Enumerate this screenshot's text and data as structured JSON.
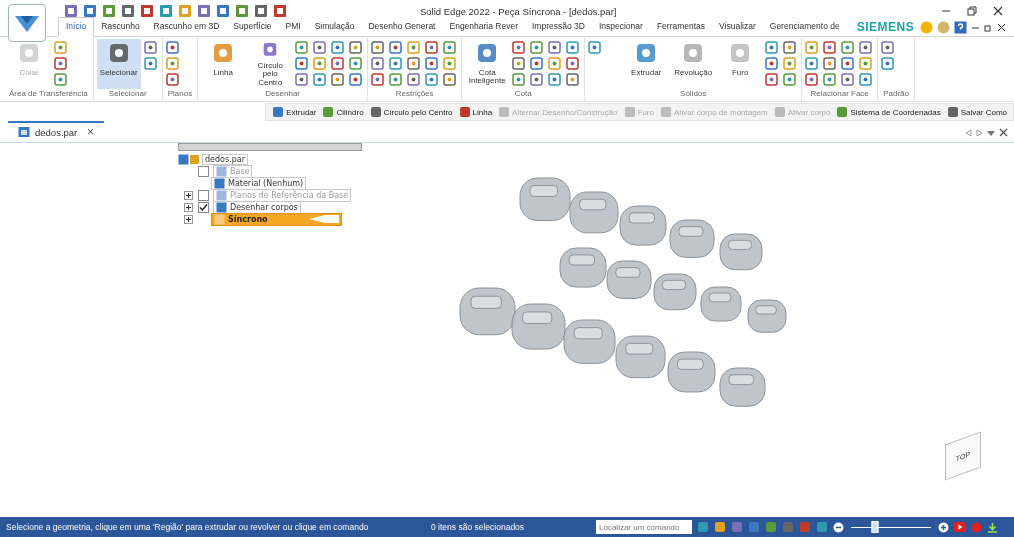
{
  "window": {
    "title": "Solid Edge 2022 - Peça Síncrona - [dedos.par]"
  },
  "tabs": [
    {
      "label": "Início",
      "selected": true
    },
    {
      "label": "Rascunho",
      "selected": false
    },
    {
      "label": "Rascunho em 3D",
      "selected": false
    },
    {
      "label": "Superfície",
      "selected": false
    },
    {
      "label": "PMI",
      "selected": false
    },
    {
      "label": "Simulação",
      "selected": false
    },
    {
      "label": "Desenho Generat",
      "selected": false
    },
    {
      "label": "Engenharia Rever",
      "selected": false
    },
    {
      "label": "Impressão 3D",
      "selected": false
    },
    {
      "label": "Inspecionar",
      "selected": false
    },
    {
      "label": "Ferramentas",
      "selected": false
    },
    {
      "label": "Visualizar",
      "selected": false
    },
    {
      "label": "Gerenciamento de",
      "selected": false
    }
  ],
  "brand": "SIEMENS",
  "ribbon": [
    {
      "label": "Área de Transferência",
      "buttons": [
        {
          "label": "Colar",
          "disabled": true,
          "selected": false
        }
      ]
    },
    {
      "label": "Selecionar",
      "buttons": [
        {
          "label": "Selecionar",
          "disabled": false,
          "selected": true
        }
      ]
    },
    {
      "label": "Planos"
    },
    {
      "label": "Desenhar",
      "buttons": [
        {
          "label": "Linha",
          "disabled": false,
          "selected": false
        },
        {
          "label": "Círculo pelo Centro",
          "disabled": false,
          "selected": false
        }
      ]
    },
    {
      "label": "Restrições"
    },
    {
      "label": "Cota",
      "buttons": [
        {
          "label": "Cota Inteligente",
          "disabled": false,
          "selected": false
        }
      ]
    },
    {
      "label": "Sólidos",
      "buttons": [
        {
          "label": "Extrudar",
          "disabled": false,
          "selected": false
        },
        {
          "label": "Revolução",
          "disabled": false,
          "selected": false
        },
        {
          "label": "Furo",
          "disabled": false,
          "selected": false
        }
      ]
    },
    {
      "label": "Relacionar Face"
    },
    {
      "label": "Padrão"
    }
  ],
  "command_bar": [
    {
      "label": "Extrudar",
      "disabled": false
    },
    {
      "label": "Cilindro",
      "disabled": false
    },
    {
      "label": "Círculo pelo Centro",
      "disabled": false
    },
    {
      "label": "Linha",
      "disabled": false
    },
    {
      "label": "Alternar Desenho/Construção",
      "disabled": true
    },
    {
      "label": "Furo",
      "disabled": true
    },
    {
      "label": "Ativar corpo de montagem",
      "disabled": true
    },
    {
      "label": "Ativar corpo",
      "disabled": true
    },
    {
      "label": "Sistema de Coordenadas",
      "disabled": false
    },
    {
      "label": "Salvar Como",
      "disabled": false
    }
  ],
  "document_tab": {
    "label": "dedos.par",
    "close": "×"
  },
  "tree": {
    "label": "dedos.par",
    "children": [
      {
        "label": "Base",
        "checked": false,
        "disabled": true,
        "expandable": false,
        "selected": false
      },
      {
        "label": "Material (Nenhum)",
        "disabled": false,
        "expandable": false,
        "selected": false
      },
      {
        "label": "Planos de Referência da Base",
        "checked": false,
        "disabled": true,
        "expandable": true,
        "selected": false
      },
      {
        "label": "Desenhar corpos",
        "checked": true,
        "disabled": false,
        "expandable": true,
        "selected": false
      },
      {
        "label": "Síncrono",
        "disabled": false,
        "expandable": true,
        "selected": true
      }
    ]
  },
  "view_cube": {
    "label": "TOP"
  },
  "status_bar": {
    "message": "Selecione a geometria, clique em uma 'Região' para extrudar ou revolver ou clique em comando",
    "selection": "0 itens são selecionados",
    "search": {
      "placeholder": "Localizar um comando"
    },
    "zoom": {
      "level": 0.3
    }
  }
}
